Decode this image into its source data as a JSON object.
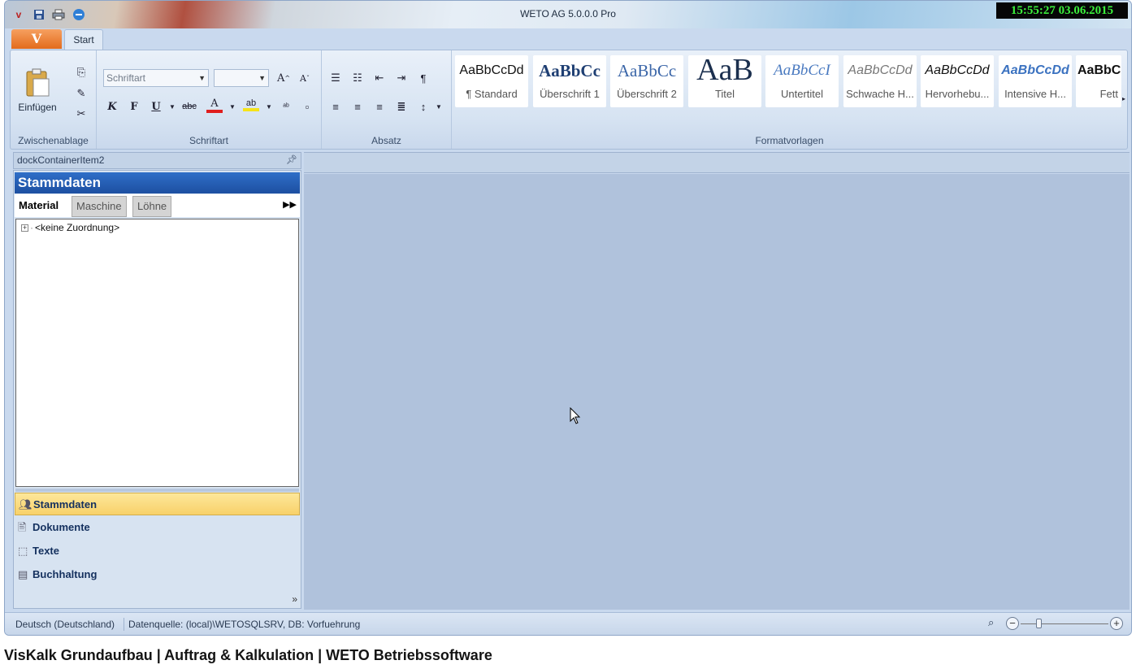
{
  "window": {
    "title": "WETO AG 5.0.0.0 Pro",
    "clock": "15:55:27 03.06.2015"
  },
  "quick_access": {
    "icons": [
      "app-logo-icon",
      "save-icon",
      "print-icon",
      "minus-circle-icon"
    ]
  },
  "ribbon": {
    "app_button": "V",
    "tabs": [
      {
        "label": "Start"
      }
    ],
    "groups": {
      "clipboard": {
        "label": "Zwischenablage",
        "paste_label": "Einfügen"
      },
      "font": {
        "label": "Schriftart",
        "font_placeholder": "Schriftart",
        "size_value": ""
      },
      "paragraph": {
        "label": "Absatz"
      },
      "styles": {
        "label": "Formatvorlagen",
        "items": [
          {
            "sample": "AaBbCcDd",
            "name": "¶ Standard"
          },
          {
            "sample": "AaBbCc",
            "name": "Überschrift 1"
          },
          {
            "sample": "AaBbCc",
            "name": "Überschrift 2"
          },
          {
            "sample": "AaB",
            "name": "Titel"
          },
          {
            "sample": "AaBbCcI",
            "name": "Untertitel"
          },
          {
            "sample": "AaBbCcDd",
            "name": "Schwache H..."
          },
          {
            "sample": "AaBbCcDd",
            "name": "Hervorhebu..."
          },
          {
            "sample": "AaBbCcDd",
            "name": "Intensive H..."
          },
          {
            "sample": "AaBbC",
            "name": "Fett"
          }
        ]
      }
    }
  },
  "dock": {
    "header": "dockContainerItem2"
  },
  "nav": {
    "title": "Stammdaten",
    "tabs": [
      "Material",
      "Maschine",
      "Löhne"
    ],
    "tree": [
      "<keine Zuordnung>"
    ],
    "items": [
      "Stammdaten",
      "Dokumente",
      "Texte",
      "Buchhaltung"
    ]
  },
  "status": {
    "language": "Deutsch (Deutschland)",
    "datasource": "Datenquelle: (local)\\WETOSQLSRV, DB: Vorfuehrung",
    "zoom_level": 0.2
  },
  "caption": "VisKalk Grundaufbau | Auftrag & Kalkulation | WETO Betriebssoftware",
  "colors": {
    "accent": "#1d4fa1",
    "active_nav": "#f8d16a",
    "clock_text": "#3cf03c"
  }
}
